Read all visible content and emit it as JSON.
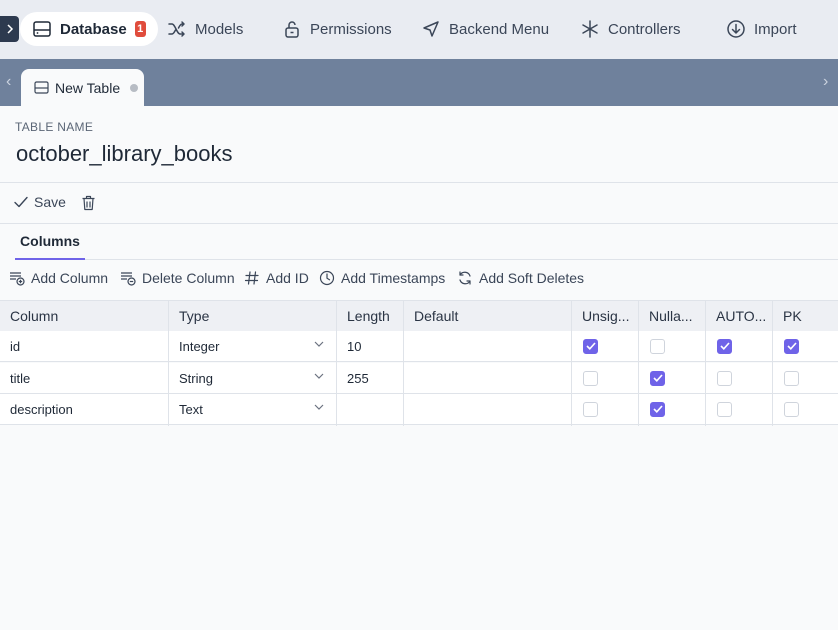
{
  "nav": {
    "items": [
      {
        "label": "Database",
        "icon": "database-icon",
        "badge": "1",
        "active": true
      },
      {
        "label": "Models",
        "icon": "shuffle-icon"
      },
      {
        "label": "Permissions",
        "icon": "lock-icon"
      },
      {
        "label": "Backend Menu",
        "icon": "navigation-icon"
      },
      {
        "label": "Controllers",
        "icon": "asterisk-icon"
      },
      {
        "label": "Import",
        "icon": "download-circle-icon"
      }
    ]
  },
  "tabs": [
    {
      "label": "New Table",
      "icon": "table-icon",
      "unsaved": true
    }
  ],
  "table_name": {
    "label": "TABLE NAME",
    "value": "october_library_books"
  },
  "toolbar": {
    "save_label": "Save",
    "delete_icon": "trash-icon"
  },
  "columns_tab": {
    "label": "Columns"
  },
  "actions": [
    {
      "label": "Add Column",
      "icon": "add-row-icon"
    },
    {
      "label": "Delete Column",
      "icon": "delete-row-icon"
    },
    {
      "label": "Add ID",
      "icon": "hash-icon"
    },
    {
      "label": "Add Timestamps",
      "icon": "clock-icon"
    },
    {
      "label": "Add Soft Deletes",
      "icon": "refresh-icon"
    }
  ],
  "grid": {
    "headers": [
      "Column",
      "Type",
      "Length",
      "Default",
      "Unsig...",
      "Nulla...",
      "AUTO...",
      "PK"
    ],
    "rows": [
      {
        "column": "id",
        "type": "Integer",
        "length": "10",
        "default": "",
        "unsigned": true,
        "nullable": false,
        "auto_increment": true,
        "pk": true
      },
      {
        "column": "title",
        "type": "String",
        "length": "255",
        "default": "",
        "unsigned": false,
        "nullable": true,
        "auto_increment": false,
        "pk": false
      },
      {
        "column": "description",
        "type": "Text",
        "length": "",
        "default": "",
        "unsigned": false,
        "nullable": true,
        "auto_increment": false,
        "pk": false
      }
    ]
  },
  "colors": {
    "accent": "#6f63e8",
    "tabbar": "#6f819c",
    "badge": "#e04c3c",
    "nav_bg": "#e9ecf2"
  }
}
